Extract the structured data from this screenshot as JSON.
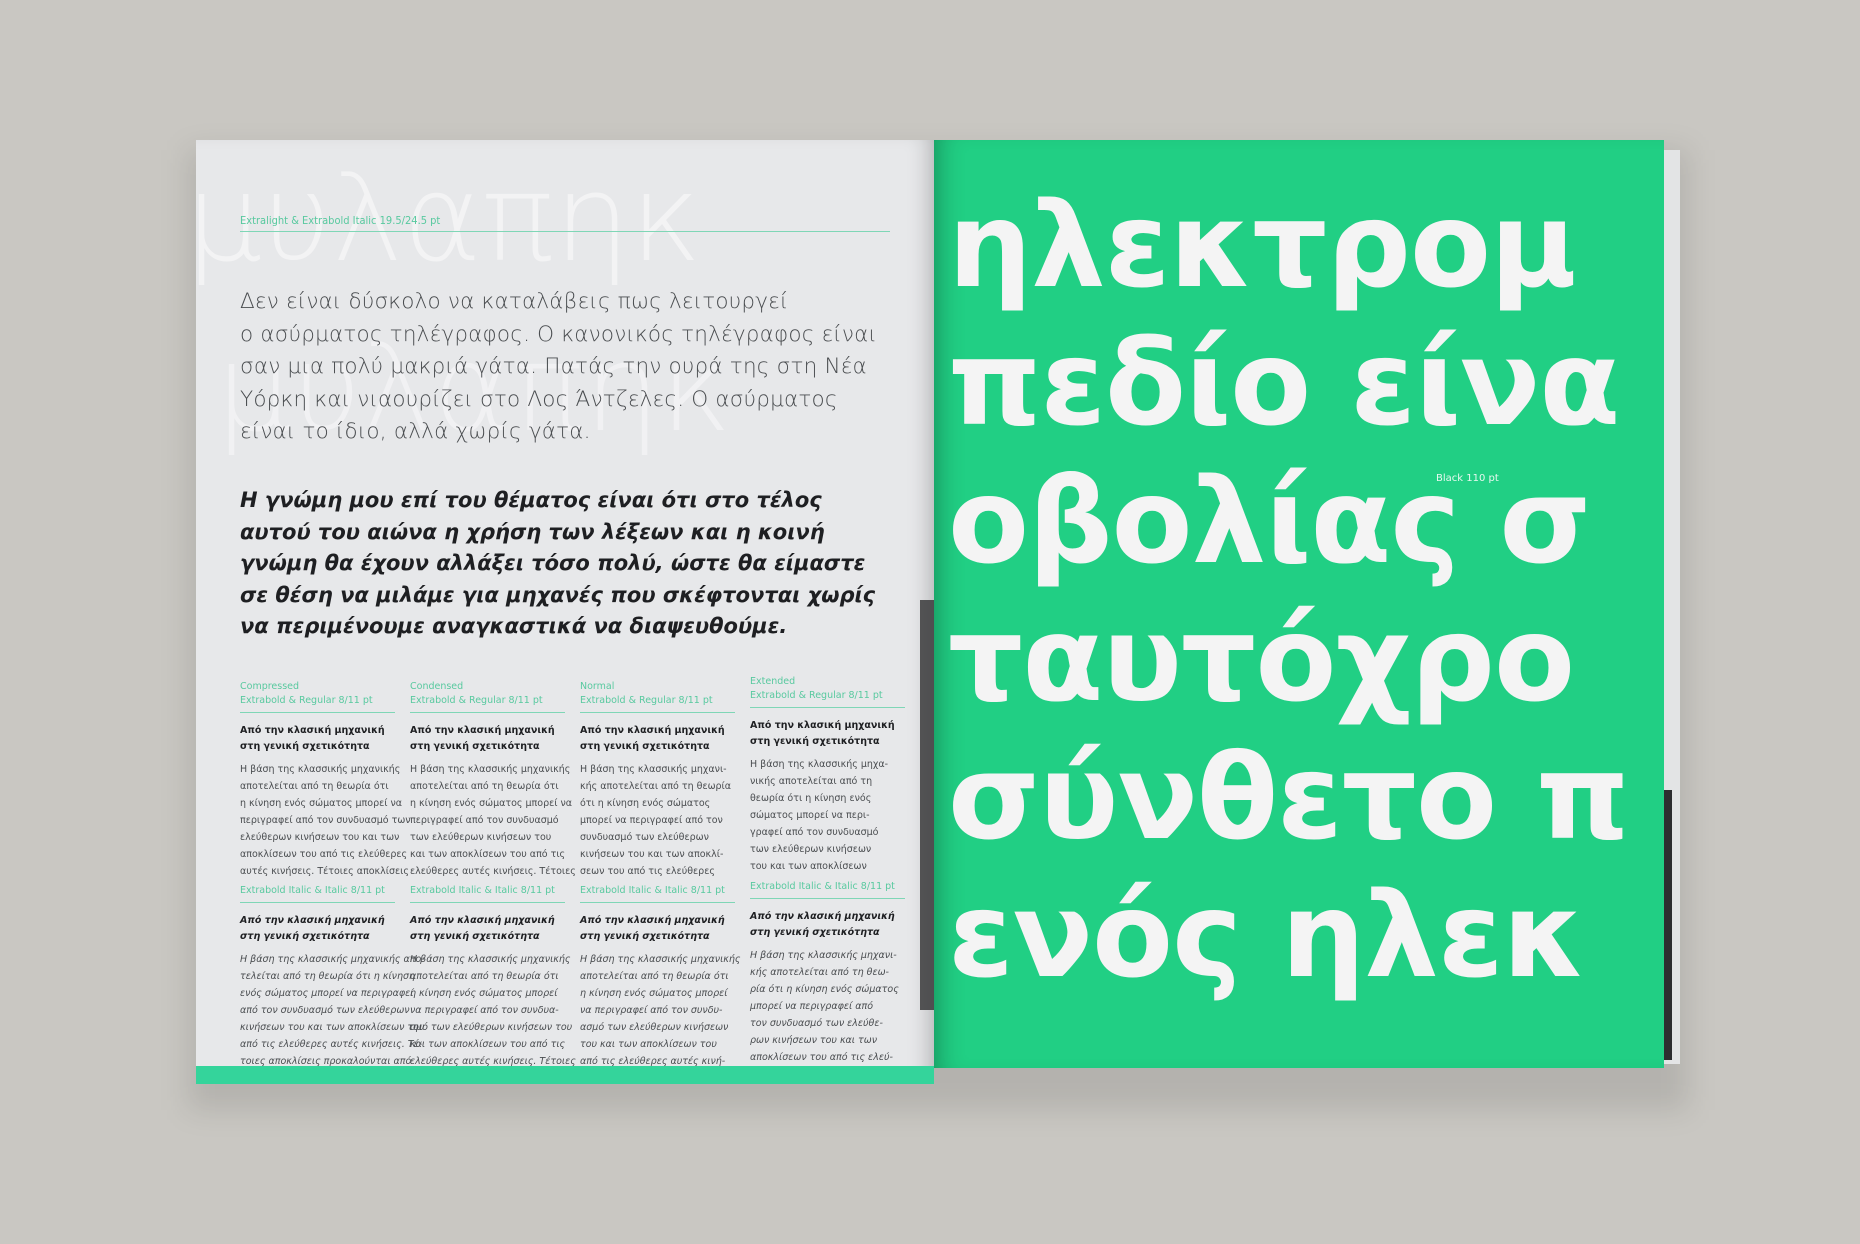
{
  "left_page": {
    "ghost_text": "μυλαπηκ",
    "header_caption": "Extralight & Extrabold Italic 19.5/24.5 pt",
    "light_paragraph": [
      "Δεν είναι δύσκολο να καταλάβεις πως λειτουργεί",
      "ο ασύρματος τηλέγραφος. Ο κανονικός τηλέγραφος είναι",
      "σαν μια πολύ μακριά γάτα. Πατάς την ουρά της στη Νέα",
      "Υόρκη και νιαουρίζει στο Λος Άντζελες. Ο ασύρματος",
      "είναι το ίδιο, αλλά χωρίς γάτα."
    ],
    "bold_paragraph": [
      "Η γνώμη μου επί του θέματος είναι ότι στο τέλος",
      "αυτού του αιώνα η χρήση των λέξεων και η κοινή",
      "γνώμη θα έχουν αλλάξει τόσο πολύ, ώστε θα είμαστε",
      "σε θέση να μιλάμε για μηχανές που σκέφτονται χωρίς",
      "να περιμένουμε αναγκαστικά να διαψευθούμε."
    ],
    "columns_top": [
      {
        "caption1": "Compressed",
        "caption2": "Extrabold & Regular 8/11 pt",
        "heading": [
          "Από την κλασική μηχανική",
          "στη γενική σχετικότητα"
        ],
        "text": [
          "Η βάση της κλασσικής μηχανικής",
          "αποτελείται από τη θεωρία ότι",
          "η κίνηση ενός σώματος μπορεί να",
          "περιγραφεί από τον συνδυασμό των",
          "ελεύθερων κινήσεων του και των",
          "αποκλίσεων του από τις ελεύθερες",
          "αυτές κινήσεις. Τέτοιες αποκλίσεις"
        ]
      },
      {
        "caption1": "Condensed",
        "caption2": "Extrabold & Regular 8/11 pt",
        "heading": [
          "Από την κλασική μηχανική",
          "στη γενική σχετικότητα"
        ],
        "text": [
          "Η βάση της κλασσικής μηχανικής",
          "αποτελείται από τη θεωρία ότι",
          "η κίνηση ενός σώματος μπορεί να",
          "περιγραφεί από τον συνδυασμό",
          "των ελεύθερων κινήσεων του",
          "και των αποκλίσεων του από τις",
          "ελεύθερες αυτές κινήσεις. Τέτοιες"
        ]
      },
      {
        "caption1": "Normal",
        "caption2": "Extrabold & Regular 8/11 pt",
        "heading": [
          "Από την κλασική μηχανική",
          "στη γενική σχετικότητα"
        ],
        "text": [
          "Η βάση της κλασσικής μηχανι-",
          "κής αποτελείται από τη θεωρία",
          "ότι η κίνηση ενός σώματος",
          "μπορεί να περιγραφεί από τον",
          "συνδυασμό των ελεύθερων",
          "κινήσεων του και των αποκλί-",
          "σεων του από τις ελεύθερες"
        ]
      },
      {
        "caption1": "Extended",
        "caption2": "Extrabold & Regular 8/11 pt",
        "heading": [
          "Από την κλασική μηχανική",
          "στη γενική σχετικότητα"
        ],
        "text": [
          "Η βάση της κλασσικής μηχα-",
          "νικής αποτελείται από τη",
          "θεωρία ότι η κίνηση ενός",
          "σώματος μπορεί να περι-",
          "γραφεί από τον συνδυασμό",
          "των ελεύθερων κινήσεων",
          "του και των αποκλίσεων"
        ]
      }
    ],
    "columns_bottom": [
      {
        "caption": "Extrabold Italic & Italic 8/11 pt",
        "heading": [
          "Από την κλασική μηχανική",
          "στη γενική σχετικότητα"
        ],
        "text": [
          "Η βάση της κλασσικής μηχανικής απο-",
          "τελείται από τη θεωρία ότι η κίνηση",
          "ενός σώματος μπορεί να περιγραφεί",
          "από τον συνδυασμό των ελεύθερων",
          "κινήσεων του και των αποκλίσεων του",
          "από τις ελεύθερες αυτές κινήσεις. Τέ-",
          "τοιες αποκλίσεις προκαλούνται από"
        ]
      },
      {
        "caption": "Extrabold Italic & Italic 8/11 pt",
        "heading": [
          "Από την κλασική μηχανική",
          "στη γενική σχετικότητα"
        ],
        "text": [
          "Η βάση της κλασσικής μηχανικής",
          "αποτελείται από τη θεωρία ότι",
          "η κίνηση ενός σώματος μπορεί",
          "να περιγραφεί από τον συνδυα-",
          "σμό των ελεύθερων κινήσεων του",
          "και των αποκλίσεων του από τις",
          "ελεύθερες αυτές κινήσεις. Τέτοιες"
        ]
      },
      {
        "caption": "Extrabold Italic & Italic 8/11 pt",
        "heading": [
          "Από την κλασική μηχανική",
          "στη γενική σχετικότητα"
        ],
        "text": [
          "Η βάση της κλασσικής μηχανικής",
          "αποτελείται από τη θεωρία ότι",
          "η κίνηση ενός σώματος μπορεί",
          "να περιγραφεί από τον συνδυ-",
          "ασμό των ελεύθερων κινήσεων",
          "του και των αποκλίσεων του",
          "από τις ελεύθερες αυτές κινή-"
        ]
      },
      {
        "caption": "Extrabold Italic & Italic 8/11 pt",
        "heading": [
          "Από την κλασική μηχανική",
          "στη γενική σχετικότητα"
        ],
        "text": [
          "Η βάση της κλασσικής μηχανι-",
          "κής αποτελείται από τη θεω-",
          "ρία ότι η κίνηση ενός σώματος",
          "μπορεί να περιγραφεί από",
          "τον συνδυασμό των ελεύθε-",
          "ρων κινήσεων του και των",
          "αποκλίσεων του από τις ελεύ-"
        ]
      }
    ]
  },
  "right_page": {
    "lines": [
      "ηλεκτρομ",
      "πεδίο είνα",
      "οβολίας σ",
      "ταυτόχρο",
      "σύνθετο π",
      "ενός ηλεκ"
    ],
    "size_label": "Black 110 pt"
  },
  "colors": {
    "background": "#c9c7c2",
    "paper": "#e7e8ea",
    "accent_green": "#21cf84",
    "caption_green": "#58c99f",
    "text_dark": "#1e1f22"
  }
}
